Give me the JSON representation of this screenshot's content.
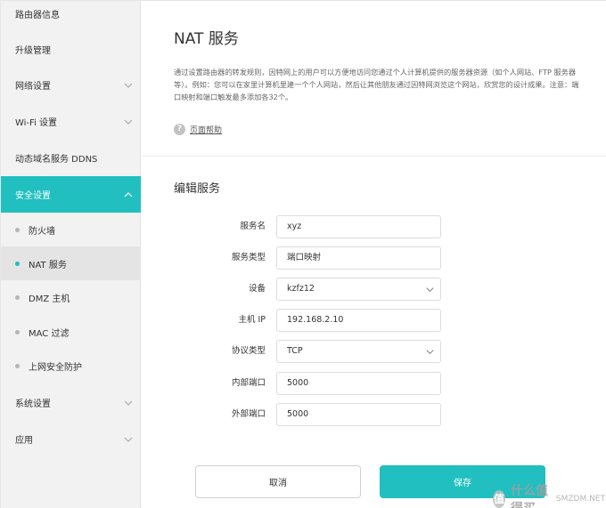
{
  "sidebar": {
    "items": [
      {
        "label": "路由器信息"
      },
      {
        "label": "升级管理"
      },
      {
        "label": "网络设置"
      },
      {
        "label": "Wi-Fi 设置"
      },
      {
        "label": "动态域名服务 DDNS"
      },
      {
        "label": "安全设置"
      },
      {
        "label": "防火墙"
      },
      {
        "label": "NAT 服务"
      },
      {
        "label": "DMZ 主机"
      },
      {
        "label": "MAC 过滤"
      },
      {
        "label": "上网安全防护"
      },
      {
        "label": "系统设置"
      },
      {
        "label": "应用"
      }
    ]
  },
  "main": {
    "title": "NAT 服务",
    "description": "通过设置路由器的转发规则，因特网上的用户可以方便地访问您通过个人计算机提供的服务器资源（如个人网站、FTP 服务器等）。例如：您可以在家里计算机里建一个个人网站，然后让其他朋友通过因特网浏览这个网站，欣赏您的设计成果。注意：端口映射和端口触发最多添加各32个。",
    "help_link": "页面帮助",
    "help_icon": "?",
    "section_title": "编辑服务",
    "form": {
      "service_name_label": "服务名",
      "service_name_value": "xyz",
      "service_type_label": "服务类型",
      "service_type_value": "端口映射",
      "device_label": "设备",
      "device_value": "kzfz12",
      "host_ip_label": "主机 IP",
      "host_ip_value": "192.168.2.10",
      "protocol_label": "协议类型",
      "protocol_value": "TCP",
      "internal_port_label": "内部端口",
      "internal_port_value": "5000",
      "external_port_label": "外部端口",
      "external_port_value": "5000"
    },
    "cancel_label": "取消",
    "save_label": "保存"
  },
  "watermark": {
    "badge": "值",
    "text": "什么值得买",
    "sub": "SMZDM.NET"
  },
  "colors": {
    "accent": "#21bfbf",
    "sidebar_bg": "#f2f2f2"
  }
}
